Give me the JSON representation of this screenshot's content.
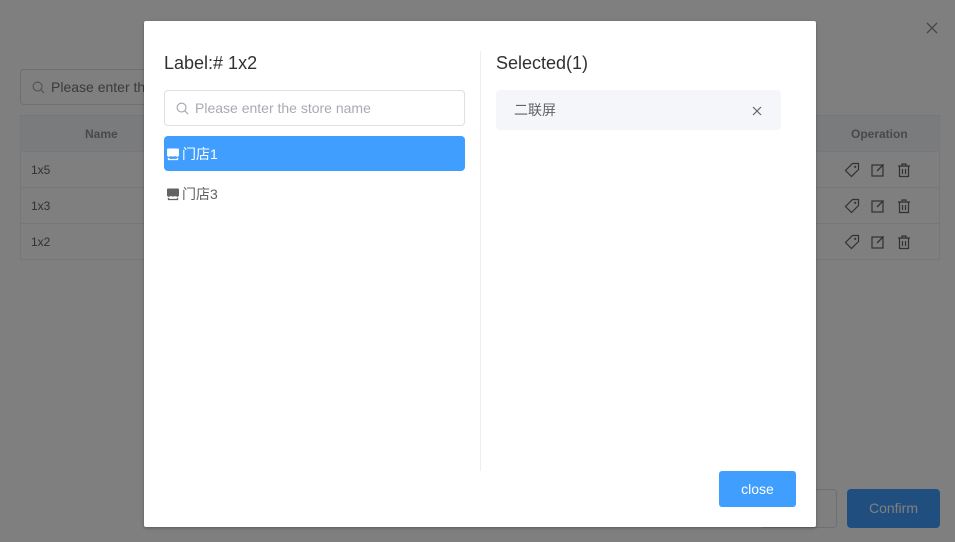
{
  "background": {
    "search": {
      "placeholder": "Please enter the store name"
    },
    "table": {
      "columns": {
        "name": "Name",
        "operation": "Operation"
      },
      "rows": [
        {
          "name": "1x5"
        },
        {
          "name": "1x3"
        },
        {
          "name": "1x2"
        }
      ]
    },
    "buttons": {
      "confirm": "Confirm"
    }
  },
  "dialog": {
    "left_title": "Label:# 1x2",
    "search": {
      "placeholder": "Please enter the store name",
      "value": ""
    },
    "stores": [
      {
        "label": "门店1",
        "active": true
      },
      {
        "label": "门店3",
        "active": false
      }
    ],
    "right_title": "Selected(1)",
    "selected": [
      {
        "label": "二联屏"
      }
    ],
    "close_label": "close"
  },
  "colors": {
    "accent": "#409eff",
    "tag_bg": "#f4f6f9",
    "mask": "rgba(0,0,0,0.5)"
  },
  "icons": {
    "store": "store-icon",
    "search": "search-icon",
    "remove": "close-icon",
    "row_ops": [
      "tag-icon",
      "edit-icon",
      "delete-icon"
    ]
  }
}
